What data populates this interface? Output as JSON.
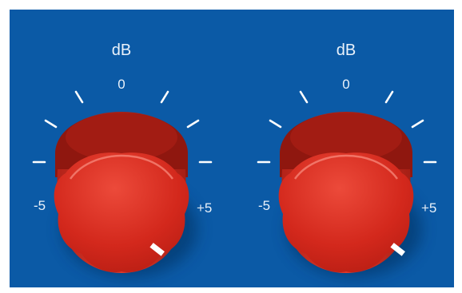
{
  "knobs": [
    {
      "id": "left",
      "unit": "dB",
      "scale": {
        "min_label": "-5",
        "mid_label": "0",
        "max_label": "+5",
        "min": -5,
        "max": 5
      },
      "value": 5,
      "colors": {
        "body": "#d72f23",
        "highlight": "#ee5a4a",
        "indicator": "#ffffff"
      }
    },
    {
      "id": "right",
      "unit": "dB",
      "scale": {
        "min_label": "-5",
        "mid_label": "0",
        "max_label": "+5",
        "min": -5,
        "max": 5
      },
      "value": 5,
      "colors": {
        "body": "#d72f23",
        "highlight": "#ee5a4a",
        "indicator": "#ffffff"
      }
    }
  ],
  "panel": {
    "background": "#0b5aa6",
    "tick_color": "#ffffff"
  }
}
